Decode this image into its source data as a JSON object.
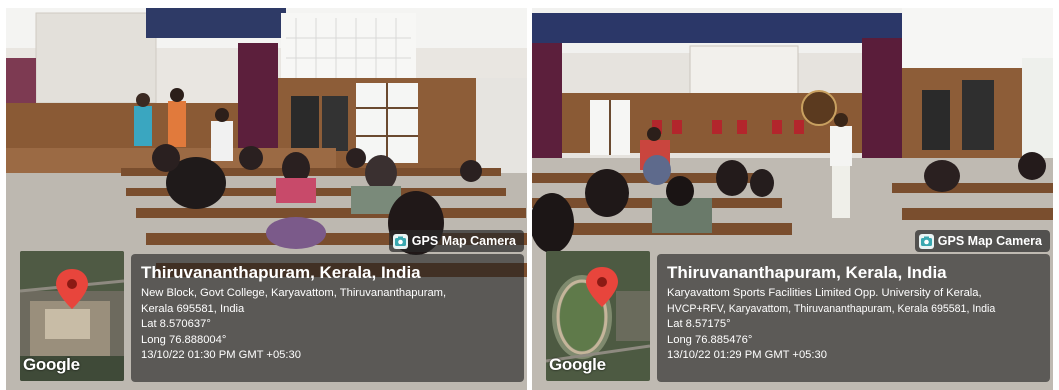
{
  "photos": [
    {
      "overlay": {
        "badge_label": "GPS Map Camera",
        "title": "Thiruvananthapuram, Kerala, India",
        "address_lines": [
          "New Block, Govt College, Karyavattom, Thiruvananthapuram,",
          "Kerala 695581, India"
        ],
        "lat": "Lat 8.570637°",
        "long": "Long 76.888004°",
        "timestamp": "13/10/22 01:30 PM GMT +05:30",
        "map_brand": "Google"
      }
    },
    {
      "overlay": {
        "badge_label": "GPS Map Camera",
        "title": "Thiruvananthapuram, Kerala, India",
        "address_lines": [
          "Karyavattom Sports Facilities Limited Opp. University of Kerala,",
          "HVCP+RFV, Karyavattom, Thiruvananthapuram, Kerala 695581, India"
        ],
        "lat": "Lat 8.57175°",
        "long": "Long 76.885476°",
        "timestamp": "13/10/22 01:29 PM GMT +05:30",
        "map_brand": "Google"
      }
    }
  ],
  "colors": {
    "wood": "#8a5a35",
    "curtain": "#5c1f3c",
    "wall": "#efefef",
    "floor": "#bdb8b0",
    "pin": "#e8453c"
  }
}
